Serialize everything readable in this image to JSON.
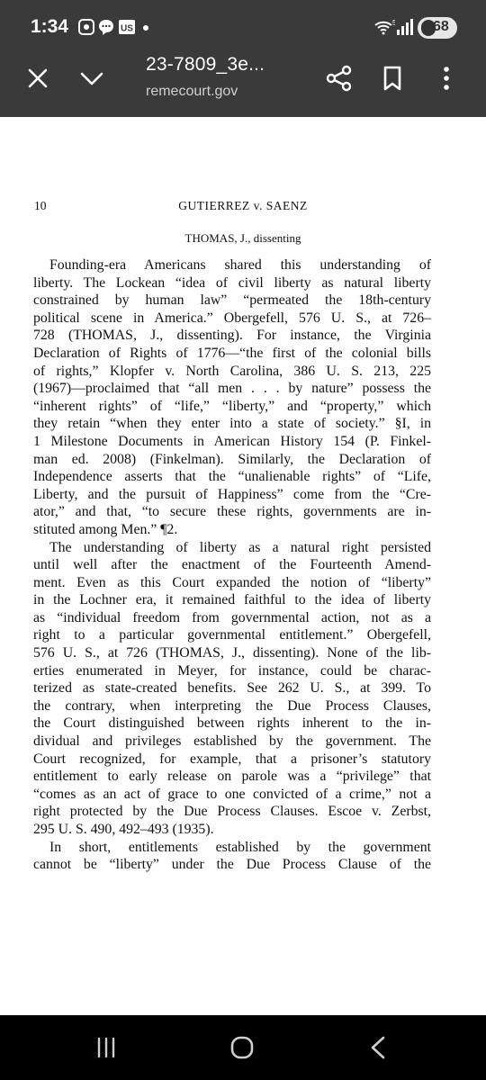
{
  "status_bar": {
    "time": "1:34",
    "battery": "68",
    "wifi_badge": "5"
  },
  "toolbar": {
    "title": "23-7809_3e...",
    "url": "remecourt.gov",
    "icons": [
      "close-icon",
      "chevron-down-icon",
      "share-icon",
      "bookmark-icon",
      "more-vert-icon"
    ]
  },
  "document": {
    "page_number": "10",
    "running_head": "GUTIERREZ v. SAENZ",
    "subheading": "THOMAS, J., dissenting",
    "lines": [
      [
        "Founding-era Americans shared this understanding of",
        "indent"
      ],
      [
        "liberty.  The Lockean “idea of civil liberty as natural liberty",
        ""
      ],
      [
        "constrained by human law” “permeated the 18th-century",
        ""
      ],
      [
        "political scene in America.”  Obergefell, 576 U. S., at 726–",
        ""
      ],
      [
        "728 (THOMAS, J., dissenting).  For instance, the Virginia",
        ""
      ],
      [
        "Declaration of Rights of 1776—“the first of the colonial bills",
        ""
      ],
      [
        "of rights,” Klopfer v. North Carolina, 386 U. S. 213, 225",
        ""
      ],
      [
        "(1967)—proclaimed that “all men . . . by nature” possess the",
        ""
      ],
      [
        "“inherent rights” of “life,” “liberty,” and “property,” which",
        ""
      ],
      [
        "they retain “when they enter into a state of society.”  §I, in",
        ""
      ],
      [
        "1 Milestone Documents in American History 154 (P. Finkel-",
        ""
      ],
      [
        "man ed. 2008) (Finkelman).  Similarly, the Declaration of",
        ""
      ],
      [
        "Independence asserts that the “unalienable rights” of “Life,",
        ""
      ],
      [
        "Liberty, and the pursuit of Happiness” come from the “Cre-",
        ""
      ],
      [
        "ator,” and that, “to secure these rights, governments are in-",
        ""
      ],
      [
        "stituted among Men.”  ¶2.",
        "last"
      ],
      [
        "The understanding of liberty as a natural right persisted",
        "indent"
      ],
      [
        "until well after the enactment of the Fourteenth Amend-",
        ""
      ],
      [
        "ment.  Even as this Court expanded the notion of “liberty”",
        ""
      ],
      [
        "in the Lochner era, it remained faithful to the idea of liberty",
        ""
      ],
      [
        "as “individual freedom from governmental action, not as a",
        ""
      ],
      [
        "right to a particular governmental entitlement.”  Obergefell,",
        ""
      ],
      [
        "576 U. S., at 726 (THOMAS, J., dissenting).  None of the lib-",
        ""
      ],
      [
        "erties enumerated in Meyer, for instance, could be charac-",
        ""
      ],
      [
        "terized as state-created benefits.  See 262 U. S., at 399.  To",
        ""
      ],
      [
        "the contrary, when interpreting the Due Process Clauses,",
        ""
      ],
      [
        "the Court distinguished between rights inherent to the in-",
        ""
      ],
      [
        "dividual and privileges established by the government.  The",
        ""
      ],
      [
        "Court recognized, for example, that a prisoner’s statutory",
        ""
      ],
      [
        "entitlement to early release on parole was a “privilege” that",
        ""
      ],
      [
        "“comes as an act of grace to one convicted of a crime,” not a",
        ""
      ],
      [
        "right protected by the Due Process Clauses.  Escoe v. Zerbst,",
        ""
      ],
      [
        "295 U. S. 490, 492–493 (1935).",
        "last"
      ],
      [
        "In short, entitlements established by the government",
        "indent"
      ],
      [
        "cannot be “liberty” under the Due Process Clause of the",
        ""
      ]
    ]
  },
  "system_nav": {
    "icons": [
      "recents-icon",
      "home-icon",
      "back-icon"
    ]
  },
  "colors": {
    "toolbar_bg": "#3a3a3a",
    "page_bg": "#ffffff",
    "nav_bg": "#000000"
  }
}
